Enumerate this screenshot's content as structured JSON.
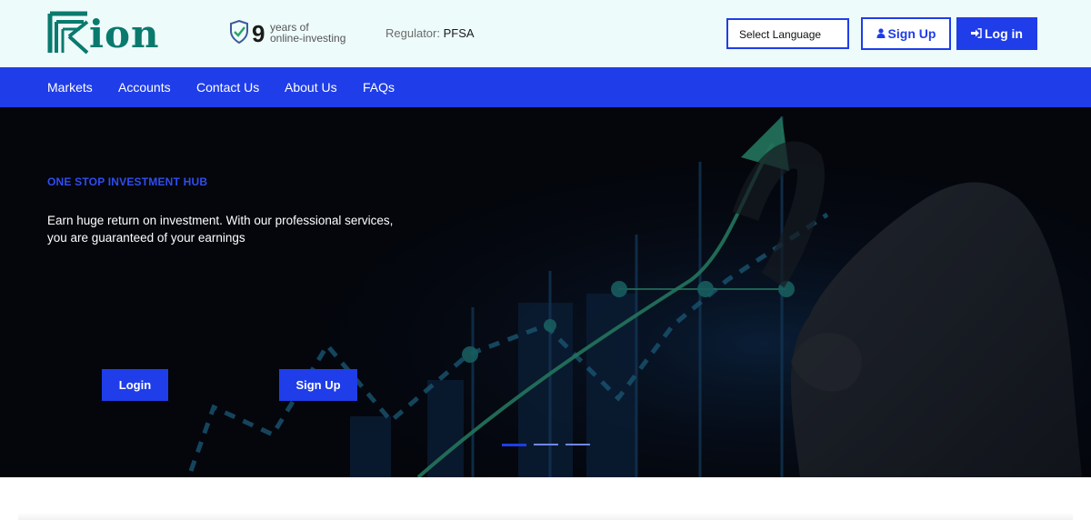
{
  "header": {
    "logo_text": "Kion",
    "years_number": "9",
    "years_line1": "years of",
    "years_line2": "online-investing",
    "regulator_label": "Regulator:",
    "regulator_value": "PFSA",
    "language_select": "Select Language",
    "signup_label": "Sign Up",
    "login_label": "Log in"
  },
  "nav": {
    "items": [
      {
        "label": "Markets"
      },
      {
        "label": "Accounts"
      },
      {
        "label": "Contact Us"
      },
      {
        "label": "About Us"
      },
      {
        "label": "FAQs"
      }
    ]
  },
  "hero": {
    "eyebrow": "ONE STOP INVESTMENT HUB",
    "line1": "Earn huge return on investment. With our professional services,",
    "line2": "you are guaranteed of your earnings",
    "login_button": "Login",
    "signup_button": "Sign Up",
    "slides": [
      {
        "active": true
      },
      {
        "active": false
      },
      {
        "active": false
      }
    ]
  },
  "colors": {
    "brand_blue": "#1f3de8",
    "logo_teal": "#0a7a6e",
    "header_bg": "#eefbfb",
    "hero_bg": "#05070d"
  },
  "icons": {
    "shield": "shield-check-icon",
    "signup": "user-icon",
    "login": "sign-in-icon"
  }
}
